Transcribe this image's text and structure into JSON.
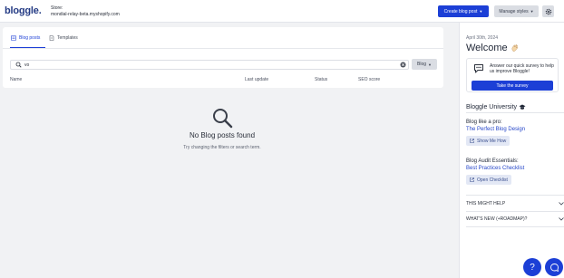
{
  "header": {
    "logo": "bloggle.",
    "store_label": "Store:",
    "store_domain": "mondial-relay-beta.myshopify.com",
    "create_button": "Create blog post",
    "manage_button": "Manage styles"
  },
  "tabs": [
    {
      "label": "Blog posts",
      "icon": "posts-icon",
      "active": true
    },
    {
      "label": "Templates",
      "icon": "template-icon",
      "active": false
    }
  ],
  "search": {
    "value": "vo",
    "filter_label": "Blog"
  },
  "table": {
    "columns": [
      "Name",
      "Last update",
      "Status",
      "SEO score"
    ]
  },
  "empty_state": {
    "title": "No Blog posts found",
    "subtitle": "Try changing the filters or search term."
  },
  "sidebar": {
    "date": "April 30th, 2024",
    "welcome": "Welcome",
    "survey_text": "Answer our quick survey to help us improve Bloggle!",
    "survey_button": "Take the survey",
    "university_title": "Bloggle University",
    "pro_label": "Blog like a pro:",
    "pro_link": "The Perfect Blog Design",
    "pro_button": "Show Me How",
    "audit_label": "Blog Audit Essentials:",
    "audit_link": "Best Practices Checklist",
    "audit_button": "Open Checklist",
    "accordions": [
      "THIS MIGHT HELP",
      "WHAT'S NEW (+ROADMAP)?"
    ]
  },
  "floating": {
    "help_label": "?"
  },
  "colors": {
    "primary": "#1c3fd6",
    "logo": "#243b84",
    "link": "#2546c9"
  }
}
